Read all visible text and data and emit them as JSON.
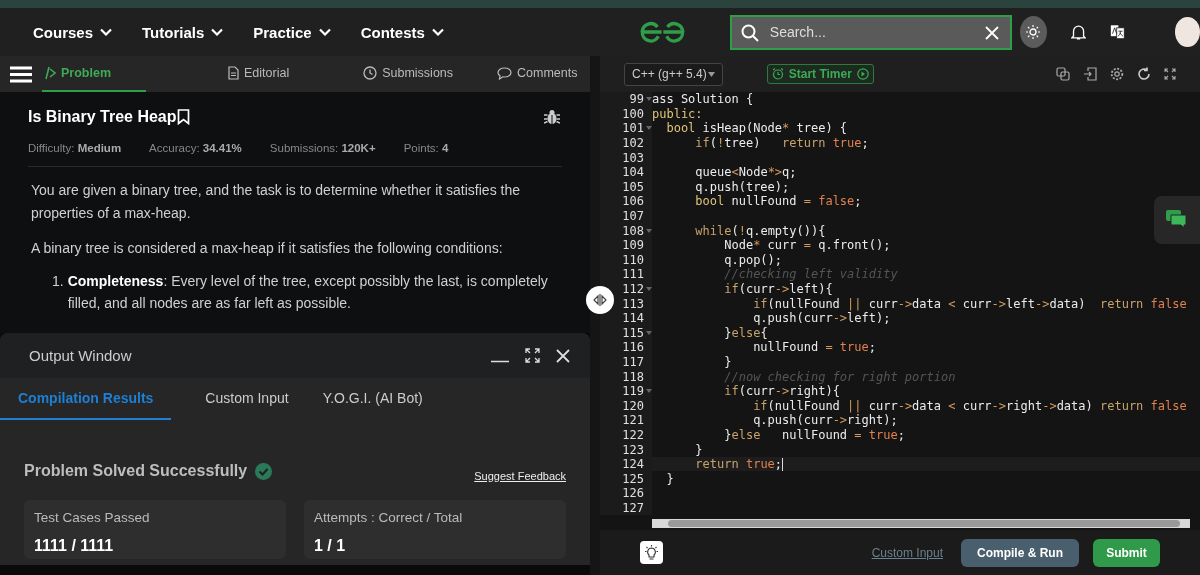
{
  "header": {
    "nav": [
      {
        "label": "Courses"
      },
      {
        "label": "Tutorials"
      },
      {
        "label": "Practice"
      },
      {
        "label": "Contests"
      }
    ],
    "search": {
      "placeholder": "Search..."
    }
  },
  "problem_tabs": [
    {
      "label": "Problem",
      "selected": true
    },
    {
      "label": "Editorial",
      "selected": false
    },
    {
      "label": "Submissions",
      "selected": false
    },
    {
      "label": "Comments",
      "selected": false
    }
  ],
  "problem": {
    "title": "Is Binary Tree Heap",
    "meta": [
      {
        "label": "Difficulty:",
        "value": "Medium"
      },
      {
        "label": "Accuracy:",
        "value": "34.41%"
      },
      {
        "label": "Submissions:",
        "value": "120K+"
      },
      {
        "label": "Points:",
        "value": "4"
      }
    ],
    "paragraphs": [
      "You are given a binary tree, and the task is to determine whether it satisfies the properties of a max-heap.",
      "A binary tree is considered a max-heap if it satisfies the following conditions:"
    ],
    "list": [
      {
        "number": "1.",
        "text": "**Completeness**: Every level of the tree, except possibly the last, is completely filled, and all nodes are as far left as possible."
      }
    ]
  },
  "output_window": {
    "title": "Output Window",
    "tabs": [
      {
        "label": "Compilation Results",
        "selected": true
      },
      {
        "label": "Custom Input",
        "selected": false
      },
      {
        "label": "Y.O.G.I. (AI Bot)",
        "selected": false
      }
    ],
    "status": "Problem Solved Successfully",
    "feedback_link": "Suggest Feedback",
    "cards": [
      {
        "label": "Test Cases Passed",
        "value": "1111 / 1111"
      },
      {
        "label": "Attempts : Correct / Total",
        "value": "1 / 1"
      }
    ]
  },
  "editor": {
    "language": "C++ (g++ 5.4)",
    "timer_button": "Start Timer",
    "lines": [
      {
        "number": "99",
        "foldable": true,
        "current": false,
        "segments": [
          {
            "kind": "plain",
            "text": "ass Solution {"
          }
        ]
      },
      {
        "number": "100",
        "foldable": false,
        "current": false,
        "segments": [
          {
            "kind": "type",
            "text": "public:"
          }
        ]
      },
      {
        "number": "101",
        "foldable": true,
        "current": false,
        "segments": [
          {
            "kind": "type",
            "text": "  bool"
          },
          {
            "kind": "plain",
            "text": " isHeap(Node"
          },
          {
            "kind": "operator",
            "text": "*"
          },
          {
            "kind": "plain",
            "text": " tree) {"
          }
        ]
      },
      {
        "number": "102",
        "foldable": false,
        "current": false,
        "segments": [
          {
            "kind": "keyword",
            "text": "      if"
          },
          {
            "kind": "plain",
            "text": "("
          },
          {
            "kind": "operator",
            "text": "!"
          },
          {
            "kind": "plain",
            "text": "tree)   "
          },
          {
            "kind": "keyword",
            "text": "return"
          },
          {
            "kind": "literal",
            "text": " true"
          },
          {
            "kind": "plain",
            "text": ";"
          }
        ]
      },
      {
        "number": "103",
        "foldable": false,
        "current": false
      },
      {
        "number": "104",
        "foldable": false,
        "current": false,
        "segments": [
          {
            "kind": "plain",
            "text": "      queue"
          },
          {
            "kind": "operator",
            "text": "<"
          },
          {
            "kind": "plain",
            "text": "Node"
          },
          {
            "kind": "operator",
            "text": "*>"
          },
          {
            "kind": "plain",
            "text": "q;"
          }
        ]
      },
      {
        "number": "105",
        "foldable": false,
        "current": false,
        "segments": [
          {
            "kind": "plain",
            "text": "      q.push(tree);"
          }
        ]
      },
      {
        "number": "106",
        "foldable": false,
        "current": false,
        "segments": [
          {
            "kind": "type",
            "text": "      bool"
          },
          {
            "kind": "plain",
            "text": " nullFound "
          },
          {
            "kind": "operator",
            "text": "="
          },
          {
            "kind": "literal",
            "text": " false"
          },
          {
            "kind": "plain",
            "text": ";"
          }
        ]
      },
      {
        "number": "107",
        "foldable": false,
        "current": false
      },
      {
        "number": "108",
        "foldable": true,
        "current": false,
        "segments": [
          {
            "kind": "keyword",
            "text": "      while"
          },
          {
            "kind": "plain",
            "text": "("
          },
          {
            "kind": "operator",
            "text": "!"
          },
          {
            "kind": "plain",
            "text": "q.empty()){"
          }
        ]
      },
      {
        "number": "109",
        "foldable": false,
        "current": false,
        "segments": [
          {
            "kind": "plain",
            "text": "          Node"
          },
          {
            "kind": "operator",
            "text": "*"
          },
          {
            "kind": "plain",
            "text": " curr "
          },
          {
            "kind": "operator",
            "text": "="
          },
          {
            "kind": "plain",
            "text": " q.front();"
          }
        ]
      },
      {
        "number": "110",
        "foldable": false,
        "current": false,
        "segments": [
          {
            "kind": "plain",
            "text": "          q.pop();"
          }
        ]
      },
      {
        "number": "111",
        "foldable": false,
        "current": false,
        "segments": [
          {
            "kind": "comment",
            "text": "          //checking left validity"
          }
        ]
      },
      {
        "number": "112",
        "foldable": true,
        "current": false,
        "segments": [
          {
            "kind": "keyword",
            "text": "          if"
          },
          {
            "kind": "plain",
            "text": "(curr"
          },
          {
            "kind": "operator",
            "text": "->"
          },
          {
            "kind": "plain",
            "text": "left){"
          }
        ]
      },
      {
        "number": "113",
        "foldable": false,
        "current": false,
        "segments": [
          {
            "kind": "keyword",
            "text": "              if"
          },
          {
            "kind": "plain",
            "text": "(nullFound "
          },
          {
            "kind": "operator",
            "text": "||"
          },
          {
            "kind": "plain",
            "text": " curr"
          },
          {
            "kind": "operator",
            "text": "->"
          },
          {
            "kind": "plain",
            "text": "data "
          },
          {
            "kind": "operator",
            "text": "<"
          },
          {
            "kind": "plain",
            "text": " curr"
          },
          {
            "kind": "operator",
            "text": "->"
          },
          {
            "kind": "plain",
            "text": "left"
          },
          {
            "kind": "operator",
            "text": "->"
          },
          {
            "kind": "plain",
            "text": "data)  "
          },
          {
            "kind": "keyword",
            "text": "return"
          },
          {
            "kind": "literal",
            "text": " false"
          }
        ]
      },
      {
        "number": "114",
        "foldable": false,
        "current": false,
        "segments": [
          {
            "kind": "plain",
            "text": "              q.push(curr"
          },
          {
            "kind": "operator",
            "text": "->"
          },
          {
            "kind": "plain",
            "text": "left);"
          }
        ]
      },
      {
        "number": "115",
        "foldable": true,
        "current": false,
        "segments": [
          {
            "kind": "plain",
            "text": "          }"
          },
          {
            "kind": "keyword",
            "text": "else"
          },
          {
            "kind": "plain",
            "text": "{"
          }
        ]
      },
      {
        "number": "116",
        "foldable": false,
        "current": false,
        "segments": [
          {
            "kind": "plain",
            "text": "              nullFound "
          },
          {
            "kind": "operator",
            "text": "="
          },
          {
            "kind": "literal",
            "text": " true"
          },
          {
            "kind": "plain",
            "text": ";"
          }
        ]
      },
      {
        "number": "117",
        "foldable": false,
        "current": false,
        "segments": [
          {
            "kind": "plain",
            "text": "          }"
          }
        ]
      },
      {
        "number": "118",
        "foldable": false,
        "current": false,
        "segments": [
          {
            "kind": "comment",
            "text": "          //now checking for right portion"
          }
        ]
      },
      {
        "number": "119",
        "foldable": true,
        "current": false,
        "segments": [
          {
            "kind": "keyword",
            "text": "          if"
          },
          {
            "kind": "plain",
            "text": "(curr"
          },
          {
            "kind": "operator",
            "text": "->"
          },
          {
            "kind": "plain",
            "text": "right){"
          }
        ]
      },
      {
        "number": "120",
        "foldable": false,
        "current": false,
        "segments": [
          {
            "kind": "keyword",
            "text": "              if"
          },
          {
            "kind": "plain",
            "text": "(nullFound "
          },
          {
            "kind": "operator",
            "text": "||"
          },
          {
            "kind": "plain",
            "text": " curr"
          },
          {
            "kind": "operator",
            "text": "->"
          },
          {
            "kind": "plain",
            "text": "data "
          },
          {
            "kind": "operator",
            "text": "<"
          },
          {
            "kind": "plain",
            "text": " curr"
          },
          {
            "kind": "operator",
            "text": "->"
          },
          {
            "kind": "plain",
            "text": "right"
          },
          {
            "kind": "operator",
            "text": "->"
          },
          {
            "kind": "plain",
            "text": "data) "
          },
          {
            "kind": "keyword",
            "text": "return"
          },
          {
            "kind": "literal",
            "text": " false"
          }
        ]
      },
      {
        "number": "121",
        "foldable": false,
        "current": false,
        "segments": [
          {
            "kind": "plain",
            "text": "              q.push(curr"
          },
          {
            "kind": "operator",
            "text": "->"
          },
          {
            "kind": "plain",
            "text": "right);"
          }
        ]
      },
      {
        "number": "122",
        "foldable": false,
        "current": false,
        "segments": [
          {
            "kind": "plain",
            "text": "          }"
          },
          {
            "kind": "keyword",
            "text": "else"
          },
          {
            "kind": "plain",
            "text": "   nullFound "
          },
          {
            "kind": "operator",
            "text": "="
          },
          {
            "kind": "literal",
            "text": " true"
          },
          {
            "kind": "plain",
            "text": ";"
          }
        ]
      },
      {
        "number": "123",
        "foldable": false,
        "current": false,
        "segments": [
          {
            "kind": "plain",
            "text": "      }"
          }
        ]
      },
      {
        "number": "124",
        "foldable": false,
        "current": true,
        "segments": [
          {
            "kind": "keyword",
            "text": "      return"
          },
          {
            "kind": "literal",
            "text": " true"
          },
          {
            "kind": "plain",
            "text": ";"
          }
        ]
      },
      {
        "number": "125",
        "foldable": false,
        "current": false,
        "segments": [
          {
            "kind": "plain",
            "text": "  }"
          }
        ]
      },
      {
        "number": "126",
        "foldable": false,
        "current": false
      },
      {
        "number": "127",
        "foldable": false,
        "current": false
      }
    ],
    "bottom": {
      "custom_input": "Custom Input",
      "compile_button": "Compile & Run",
      "submit_button": "Submit"
    }
  }
}
